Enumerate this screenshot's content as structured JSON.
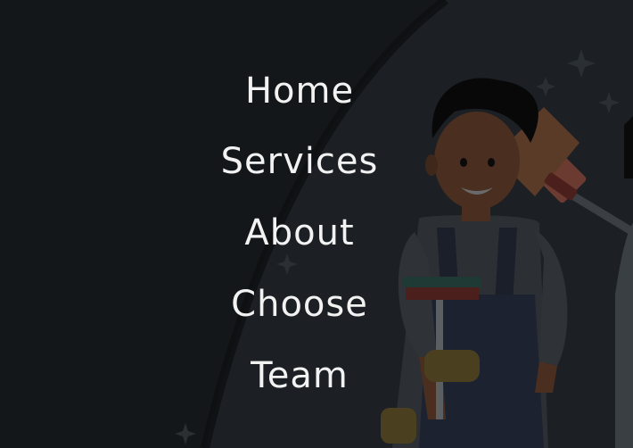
{
  "colors": {
    "background": "#141719",
    "menu_text": "#f2f2f2"
  },
  "nav": {
    "items": [
      {
        "label": "Home"
      },
      {
        "label": "Services"
      },
      {
        "label": "About"
      },
      {
        "label": "Choose"
      },
      {
        "label": "Team"
      }
    ]
  },
  "hero": {
    "illustration": "cleaner-with-broom-icon"
  }
}
